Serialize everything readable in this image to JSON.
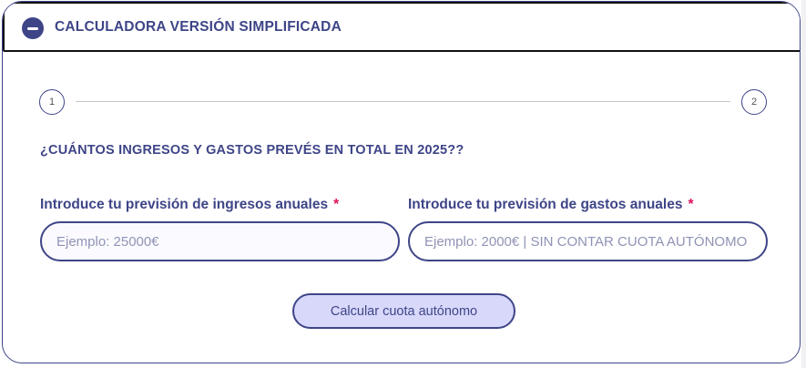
{
  "accordion": {
    "title": "CALCULADORA VERSIÓN SIMPLIFICADA",
    "icon": "minus-circle-icon"
  },
  "stepper": {
    "steps": [
      {
        "label": "1"
      },
      {
        "label": "2"
      }
    ],
    "current_step": 1
  },
  "form": {
    "question": "¿CUÁNTOS INGRESOS Y GASTOS PREVÉS EN TOTAL EN 2025??",
    "income": {
      "label": "Introduce tu previsión de ingresos anuales",
      "required_mark": "*",
      "value": "",
      "placeholder": "Ejemplo: 25000€"
    },
    "expense": {
      "label": "Introduce tu previsión de gastos anuales",
      "required_mark": "*",
      "value": "",
      "placeholder": "Ejemplo: 2000€ | SIN CONTAR CUOTA AUTÓNOMO"
    },
    "submit_label": "Calcular cuota autónomo"
  },
  "colors": {
    "primary": "#3e4587",
    "required": "#e0115f",
    "button_bg": "#d8d8fb"
  }
}
